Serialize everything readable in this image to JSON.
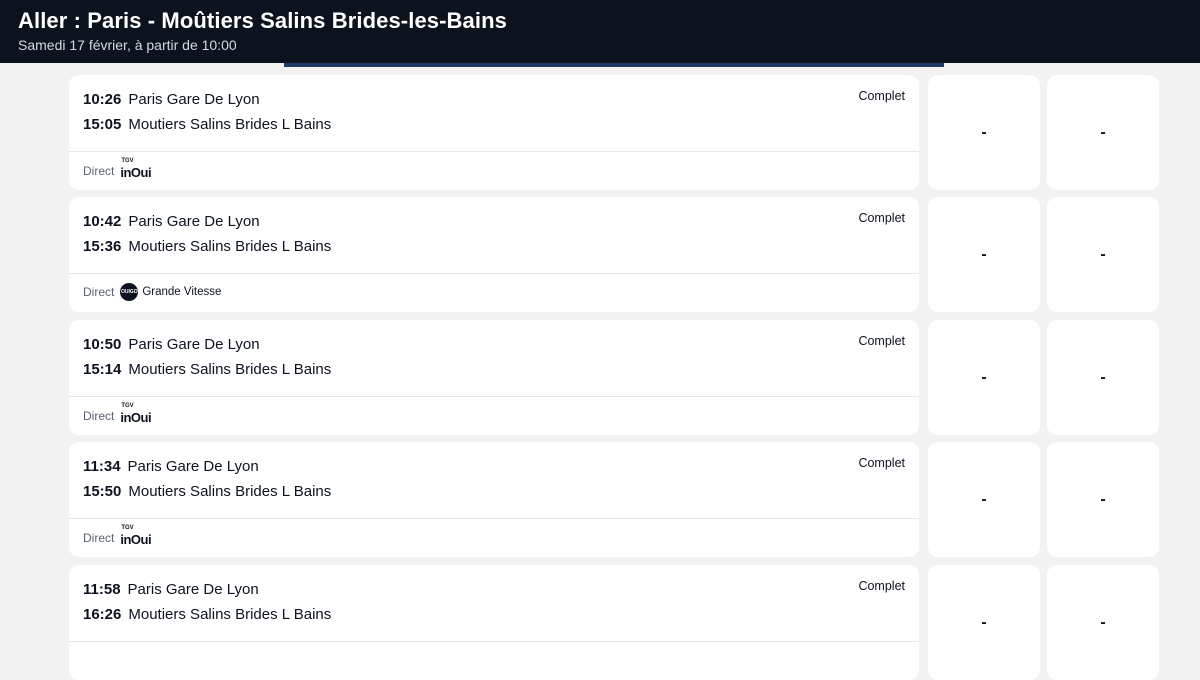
{
  "header": {
    "title": "Aller : Paris - Moûtiers Salins Brides-les-Bains",
    "subtitle": "Samedi 17 février, à partir de 10:00"
  },
  "journeys": [
    {
      "departure_time": "10:26",
      "departure_station": "Paris Gare De Lyon",
      "arrival_time": "15:05",
      "arrival_station": "Moutiers Salins Brides L Bains",
      "status": "Complet",
      "direct_label": "Direct",
      "carrier": {
        "logo_text": "inOui",
        "logo_sup": "TGV"
      },
      "price_first": "-",
      "price_second": "-"
    },
    {
      "departure_time": "10:42",
      "departure_station": "Paris Gare De Lyon",
      "arrival_time": "15:36",
      "arrival_station": "Moutiers Salins Brides L Bains",
      "status": "Complet",
      "direct_label": "Direct",
      "carrier": {
        "logo_text": "OUIGO",
        "label": "Grande Vitesse"
      },
      "price_first": "-",
      "price_second": "-"
    },
    {
      "departure_time": "10:50",
      "departure_station": "Paris Gare De Lyon",
      "arrival_time": "15:14",
      "arrival_station": "Moutiers Salins Brides L Bains",
      "status": "Complet",
      "direct_label": "Direct",
      "carrier": {
        "logo_text": "inOui",
        "logo_sup": "TGV"
      },
      "price_first": "-",
      "price_second": "-"
    },
    {
      "departure_time": "11:34",
      "departure_station": "Paris Gare De Lyon",
      "arrival_time": "15:50",
      "arrival_station": "Moutiers Salins Brides L Bains",
      "status": "Complet",
      "direct_label": "Direct",
      "carrier": {
        "logo_text": "inOui",
        "logo_sup": "TGV"
      },
      "price_first": "-",
      "price_second": "-"
    },
    {
      "departure_time": "11:58",
      "departure_station": "Paris Gare De Lyon",
      "arrival_time": "16:26",
      "arrival_station": "Moutiers Salins Brides L Bains",
      "status": "Complet",
      "price_first": "-",
      "price_second": "-"
    }
  ]
}
